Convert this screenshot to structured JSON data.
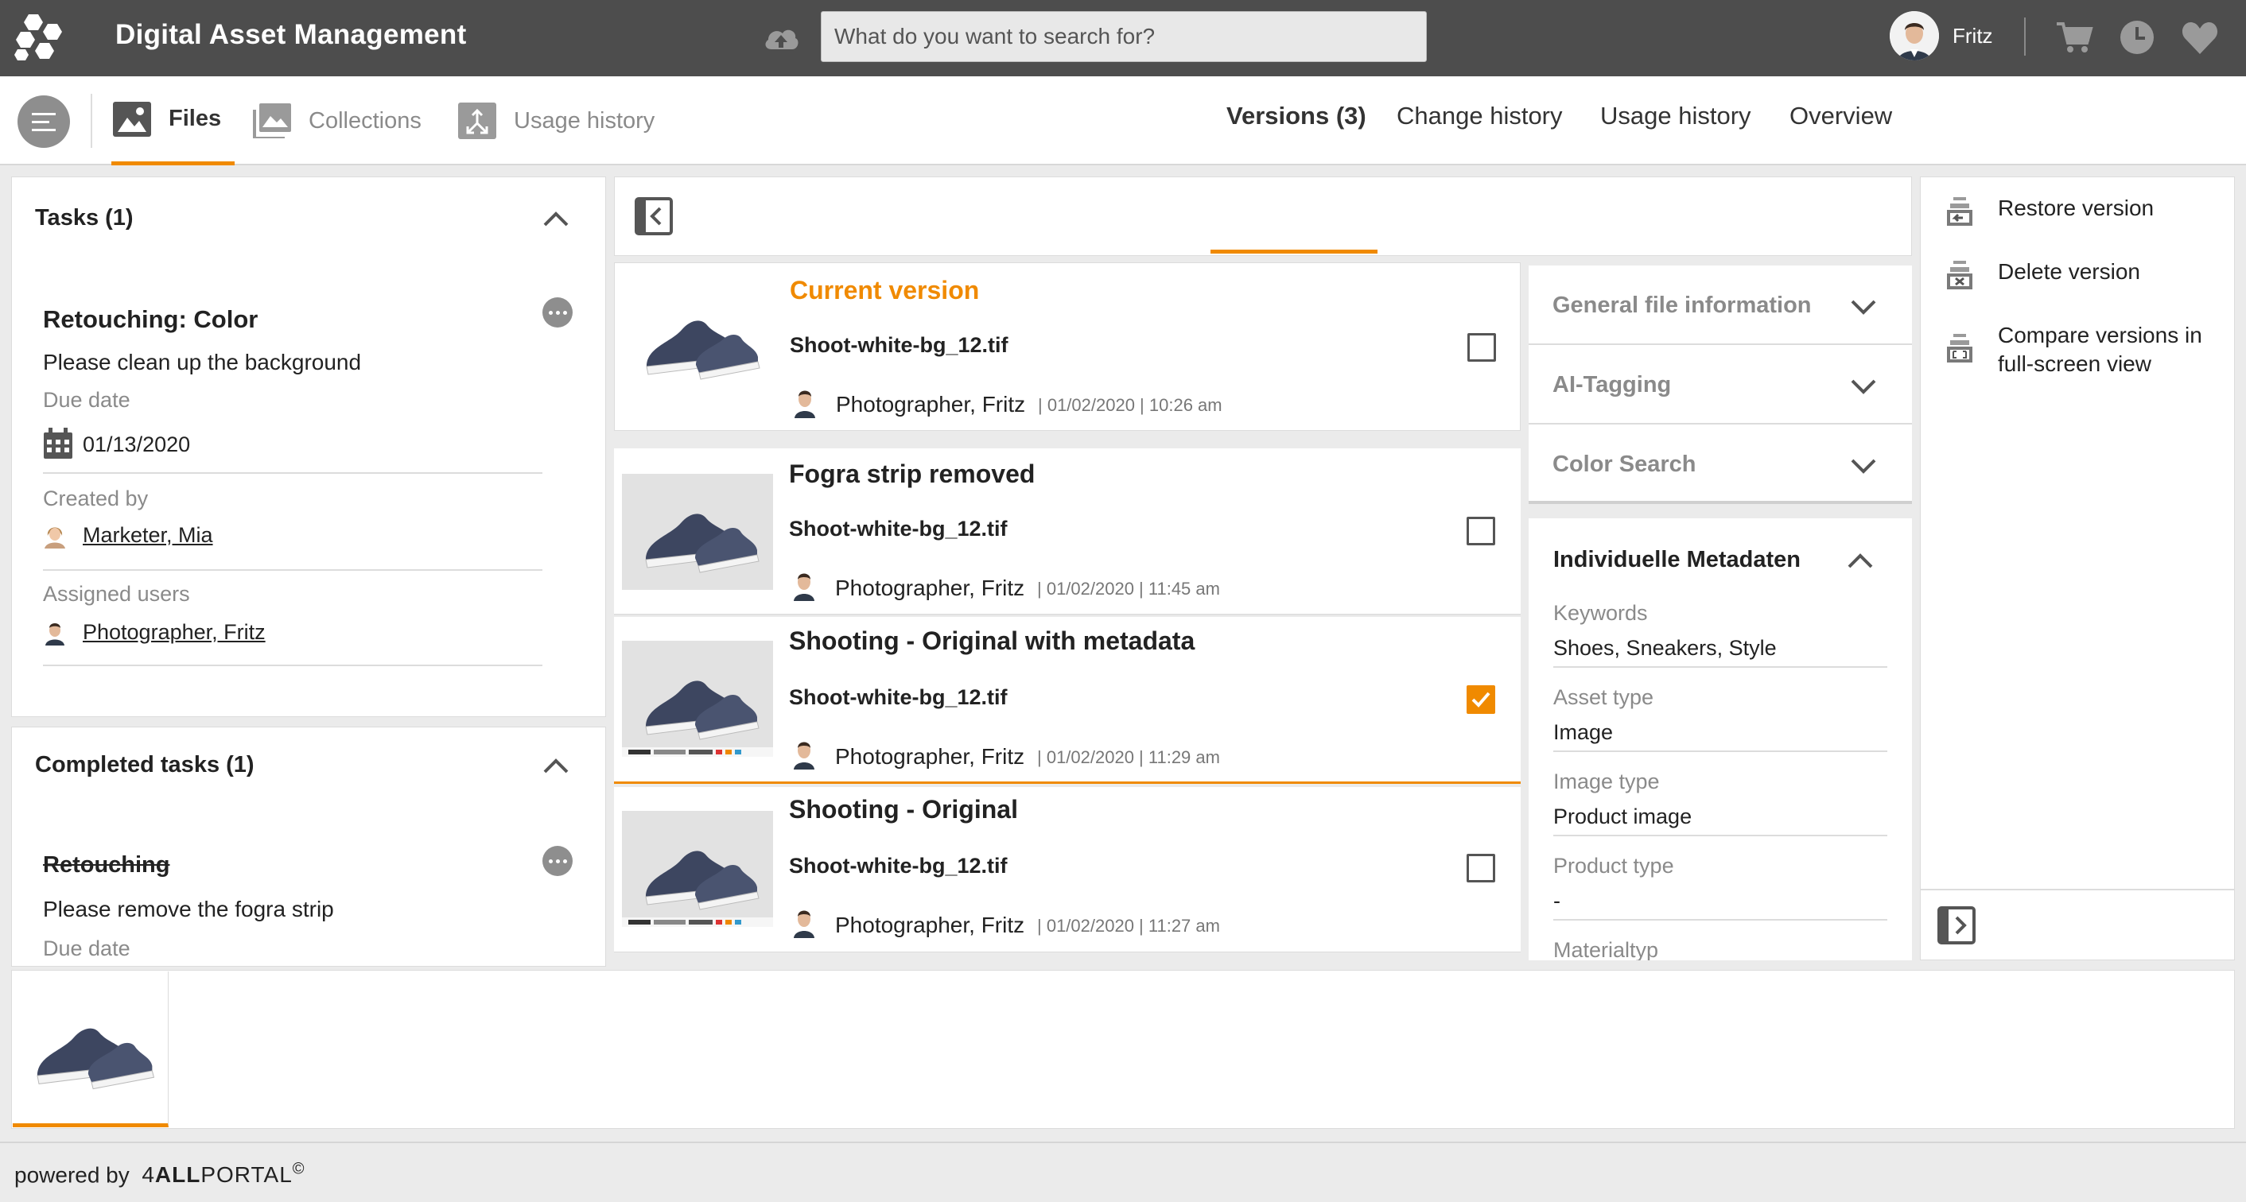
{
  "app": {
    "title": "Digital Asset Management",
    "search_placeholder": "What do you want to search for?",
    "user": "Fritz"
  },
  "subnav": {
    "tabs": [
      {
        "label": "Files",
        "active": true
      },
      {
        "label": "Collections"
      },
      {
        "label": "Usage history"
      }
    ]
  },
  "tasks": {
    "title": "Tasks (1)",
    "task": {
      "name": "Retouching: Color",
      "description": "Please clean up the background",
      "due_label": "Due date",
      "due_date": "01/13/2020",
      "created_label": "Created by",
      "created_by": "Marketer, Mia",
      "assigned_label": "Assigned users",
      "assigned": "Photographer, Fritz"
    }
  },
  "completed": {
    "title": "Completed tasks (1)",
    "task": {
      "name": "Retouching",
      "description": "Please remove the fogra strip",
      "due_label": "Due date"
    }
  },
  "versions": {
    "tabs": [
      "Versions (3)",
      "Change history",
      "Usage history",
      "Overview"
    ],
    "rows": [
      {
        "title": "Current version",
        "file": "Shoot-white-bg_12.tif",
        "author": "Photographer, Fritz",
        "stamp": "01/02/2020 | 10:26 am",
        "checked": false
      },
      {
        "title": "Fogra strip removed",
        "file": "Shoot-white-bg_12.tif",
        "author": "Photographer, Fritz",
        "stamp": "01/02/2020 | 11:45 am",
        "checked": false
      },
      {
        "title": "Shooting - Original with metadata",
        "file": "Shoot-white-bg_12.tif",
        "author": "Photographer, Fritz",
        "stamp": "01/02/2020 | 11:29 am",
        "checked": true
      },
      {
        "title": "Shooting - Original",
        "file": "Shoot-white-bg_12.tif",
        "author": "Photographer, Fritz",
        "stamp": "01/02/2020 | 11:27 am",
        "checked": false
      }
    ]
  },
  "info": {
    "sections": [
      "General file information",
      "AI-Tagging",
      "Color Search"
    ],
    "meta_title": "Individuelle Metadaten",
    "fields": [
      {
        "label": "Keywords",
        "value": "Shoes, Sneakers, Style"
      },
      {
        "label": "Asset type",
        "value": "Image"
      },
      {
        "label": "Image type",
        "value": "Product image"
      },
      {
        "label": "Product type",
        "value": "-"
      },
      {
        "label": "Materialtyp",
        "value": ""
      }
    ]
  },
  "actions": {
    "restore": "Restore version",
    "delete": "Delete version",
    "compare_1": "Compare versions in",
    "compare_2": "full-screen view"
  },
  "footer": {
    "powered": "powered by",
    "brand_pre": "4",
    "brand_bold": "ALL",
    "brand_post": "PORTAL",
    "mark": "©"
  },
  "colors": {
    "accent": "#f08a00",
    "topbar": "#4d4d4d"
  }
}
